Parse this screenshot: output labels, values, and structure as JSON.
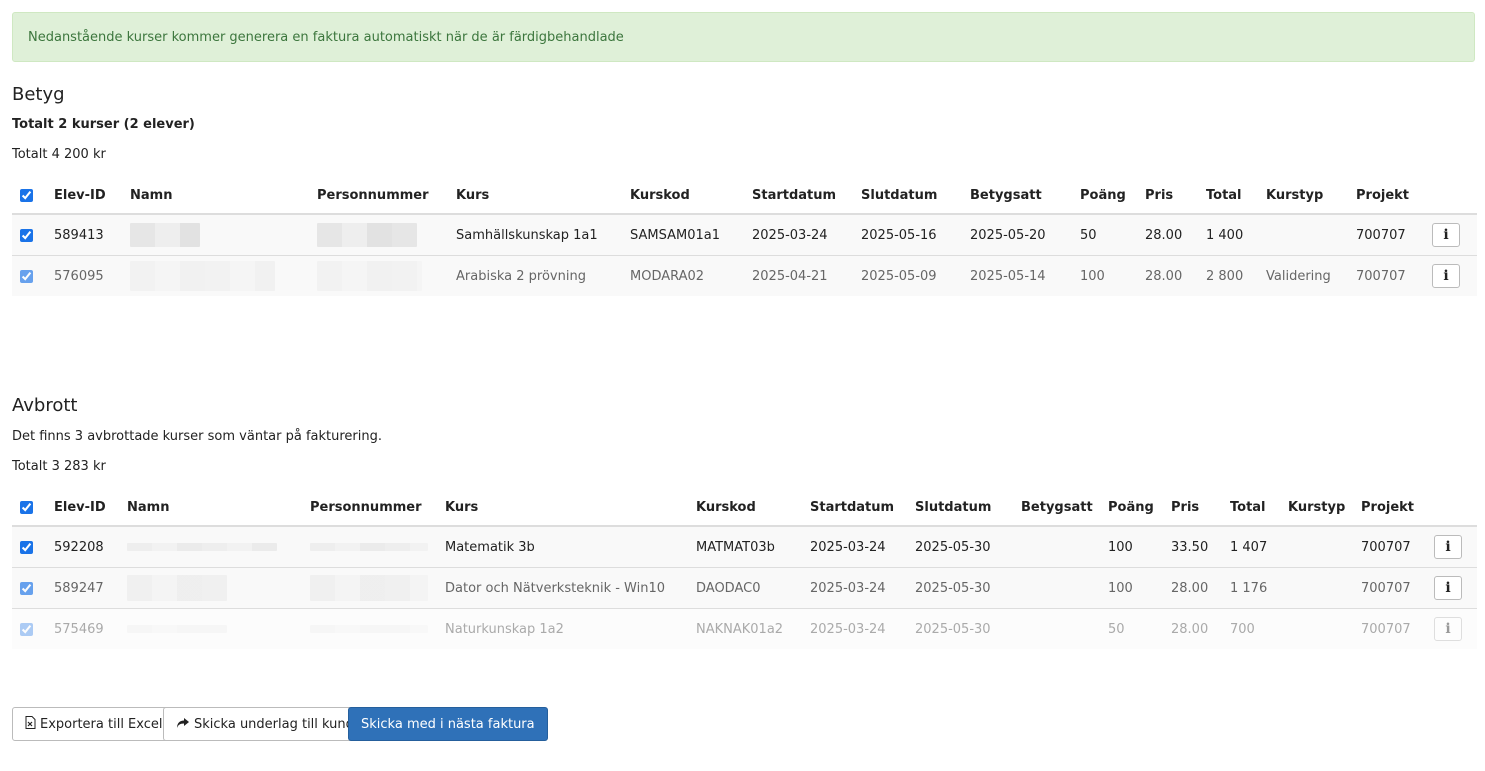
{
  "alert": {
    "text": "Nedanstående kurser kommer generera en faktura automatiskt när de är färdigbehandlade"
  },
  "betyg": {
    "title": "Betyg",
    "summary": "Totalt 2 kurser (2 elever)",
    "total": "Totalt 4 200 kr",
    "headers": [
      "Elev-ID",
      "Namn",
      "Personnummer",
      "Kurs",
      "Kurskod",
      "Startdatum",
      "Slutdatum",
      "Betygsatt",
      "Poäng",
      "Pris",
      "Total",
      "Kurstyp",
      "Projekt"
    ],
    "rows": [
      {
        "id": "589413",
        "kurs": "Samhällskunskap 1a1",
        "kod": "SAMSAM01a1",
        "start": "2025-03-24",
        "slut": "2025-05-16",
        "betygsatt": "2025-05-20",
        "poang": "50",
        "pris": "28.00",
        "total": "1 400",
        "kurstyp": "",
        "projekt": "700707"
      },
      {
        "id": "576095",
        "kurs": "Arabiska 2 prövning",
        "kod": "MODARA02",
        "start": "2025-04-21",
        "slut": "2025-05-09",
        "betygsatt": "2025-05-14",
        "poang": "100",
        "pris": "28.00",
        "total": "2 800",
        "kurstyp": "Validering",
        "projekt": "700707"
      }
    ]
  },
  "avbrott": {
    "title": "Avbrott",
    "summary": "Det finns 3 avbrottade kurser som väntar på fakturering.",
    "total": "Totalt 3 283 kr",
    "headers": [
      "Elev-ID",
      "Namn",
      "Personnummer",
      "Kurs",
      "Kurskod",
      "Startdatum",
      "Slutdatum",
      "Betygsatt",
      "Poäng",
      "Pris",
      "Total",
      "Kurstyp",
      "Projekt"
    ],
    "rows": [
      {
        "id": "592208",
        "kurs": "Matematik 3b",
        "kod": "MATMAT03b",
        "start": "2025-03-24",
        "slut": "2025-05-30",
        "betygsatt": "",
        "poang": "100",
        "pris": "33.50",
        "total": "1 407",
        "kurstyp": "",
        "projekt": "700707"
      },
      {
        "id": "589247",
        "kurs": "Dator och Nätverksteknik - Win10",
        "kod": "DAODAC0",
        "start": "2025-03-24",
        "slut": "2025-05-30",
        "betygsatt": "",
        "poang": "100",
        "pris": "28.00",
        "total": "1 176",
        "kurstyp": "",
        "projekt": "700707"
      },
      {
        "id": "575469",
        "kurs": "Naturkunskap 1a2",
        "kod": "NAKNAK01a2",
        "start": "2025-03-24",
        "slut": "2025-05-30",
        "betygsatt": "",
        "poang": "50",
        "pris": "28.00",
        "total": "700",
        "kurstyp": "",
        "projekt": "700707"
      }
    ]
  },
  "buttons": {
    "export": "Exportera till Excel",
    "send": "Skicka underlag till kund",
    "next_invoice": "Skicka med i nästa faktura"
  },
  "icons": {
    "info": "info-icon",
    "excel": "file-excel-icon",
    "share": "share-icon"
  },
  "colors": {
    "alert_bg": "#dff0d8",
    "alert_text": "#3c763d",
    "primary": "#2f71b8"
  }
}
